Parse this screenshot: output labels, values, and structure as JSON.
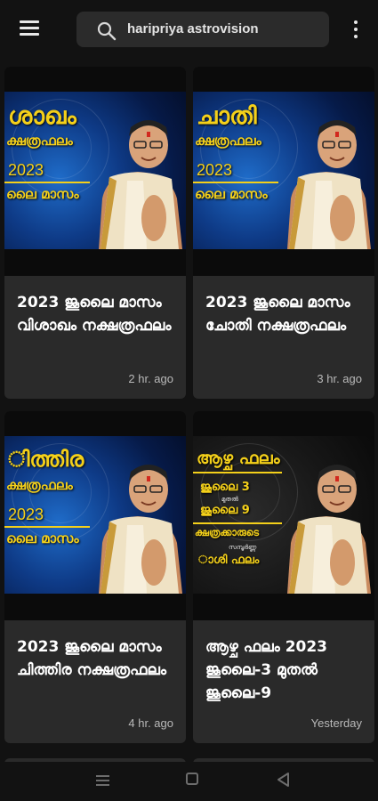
{
  "search": {
    "query": "haripriya astrovision"
  },
  "cards": [
    {
      "thumb_big": "ശാഖം",
      "thumb_mid": "ക്ഷത്രഫലം",
      "thumb_year": "2023",
      "thumb_month": "ലൈ മാസം",
      "title": "2023 ജൂലൈ മാസം വിശാഖം നക്ഷത്രഫലം",
      "time": "2 hr. ago"
    },
    {
      "thumb_big": "ചാതി",
      "thumb_mid": "ക്ഷത്രഫലം",
      "thumb_year": "2023",
      "thumb_month": "ലൈ മാസം",
      "title": "2023 ജൂലൈ മാസം ചോതി നക്ഷത്രഫലം",
      "time": "3 hr. ago"
    },
    {
      "thumb_big": "ിത്തിര",
      "thumb_mid": "ക്ഷത്രഫലം",
      "thumb_year": "2023",
      "thumb_month": "ലൈ മാസം",
      "title": "2023 ജൂലൈ മാസം ചിത്തിര നക്ഷത്രഫലം",
      "time": "4 hr. ago"
    },
    {
      "thumb_big": "ആഴ്ച ഫലം",
      "thumb_line1": "ജൂലൈ 3",
      "thumb_tiny1": "മുതൽ",
      "thumb_line2": "ജൂലൈ 9",
      "thumb_line3": "ക്ഷത്രക്കാരുടെ",
      "thumb_tiny2": "സമ്പൂർണ്ണ",
      "thumb_line4": "ാശി ഫലം",
      "title": "ആഴ്ച ഫലം 2023 ജൂലൈ-3 മുതൽ ജൂലൈ-9",
      "time": "Yesterday"
    }
  ],
  "colors": {
    "background": "#121212",
    "card": "#2a2a2a",
    "thumb_text": "#f4d01a"
  },
  "icons": [
    "menu-icon",
    "search-icon",
    "more-vert-icon",
    "nav-recents-icon",
    "nav-home-icon",
    "nav-back-icon"
  ]
}
